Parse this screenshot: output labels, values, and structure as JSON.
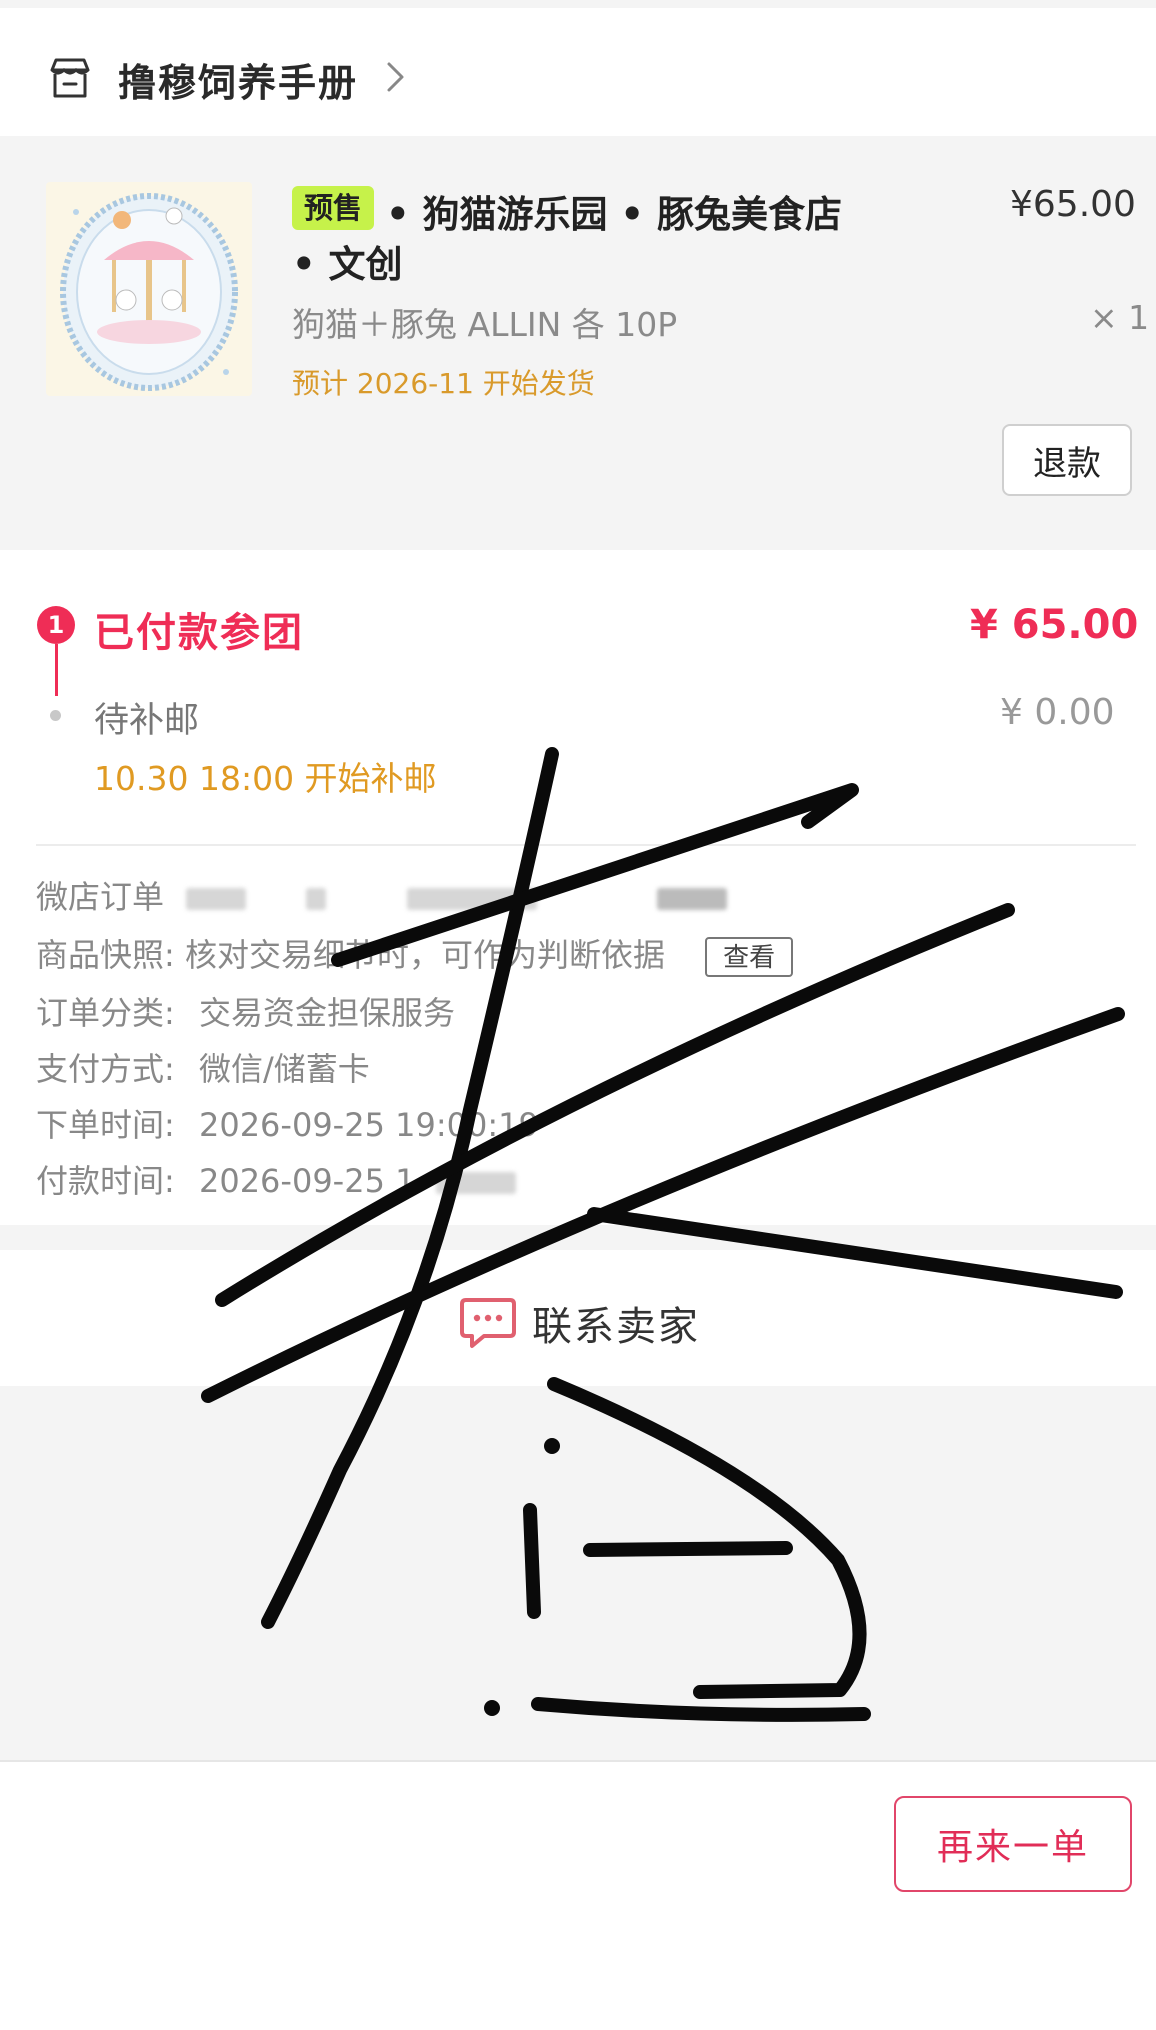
{
  "shop": {
    "name": "撸穆饲养手册",
    "icon": "shop-icon",
    "chevron": "chevron-right-icon"
  },
  "product": {
    "badge": "预售",
    "title_line1": "• 狗猫游乐园 • 豚兔美食店",
    "title_line2": "• 文创",
    "price": "¥65.00",
    "spec": "狗猫＋豚兔 ALLIN 各 10P",
    "qty": "× 1",
    "ship_estimate": "预计 2026-11 开始发货",
    "refund_label": "退款"
  },
  "status": {
    "step_number": "1",
    "paid_label": "已付款参团",
    "paid_amount": "¥ 65.00",
    "postage_label": "待补邮",
    "postage_amount": "¥ 0.00",
    "postage_note": "10.30 18:00 开始补邮"
  },
  "order_info": {
    "order_no_label": "微店订单",
    "snapshot_label": "商品快照:",
    "snapshot_value": "核对交易细节时，可作为判断依据",
    "snapshot_button": "查看",
    "category_label": "订单分类:",
    "category_value": "交易资金担保服务",
    "payment_label": "支付方式:",
    "payment_value": "微信/储蓄卡",
    "order_time_label": "下单时间:",
    "order_time_value": "2026-09-25 19:00:19",
    "pay_time_label": "付款时间:",
    "pay_time_value": "2026-09-25 1"
  },
  "contact": {
    "label": "联系卖家",
    "icon": "chat-bubble-icon"
  },
  "actions": {
    "reorder_label": "再来一单"
  },
  "colors": {
    "accent": "#ef2d56",
    "warning": "#e09a22",
    "badge": "#c6f24a"
  }
}
